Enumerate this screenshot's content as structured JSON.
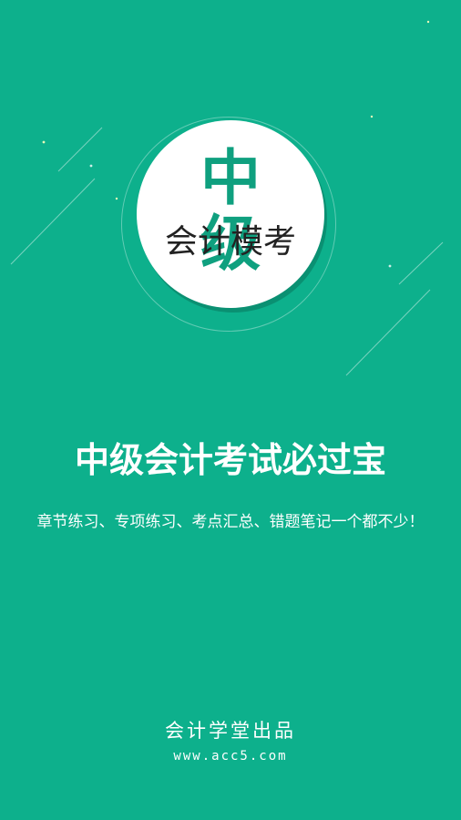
{
  "theme": {
    "background": "#0db08c",
    "accent": "#0fa07f",
    "badge_background": "#ffffff",
    "badge_subtitle_color": "#222222",
    "text_on_background": "#ffffff"
  },
  "badge": {
    "title": "中 级",
    "subtitle": "会计模考"
  },
  "headline": "中级会计考试必过宝",
  "tagline": "章节练习、专项练习、考点汇总、错题笔记一个都不少！",
  "footer": {
    "publisher": "会计学堂出品",
    "website": "www.acc5.com"
  }
}
